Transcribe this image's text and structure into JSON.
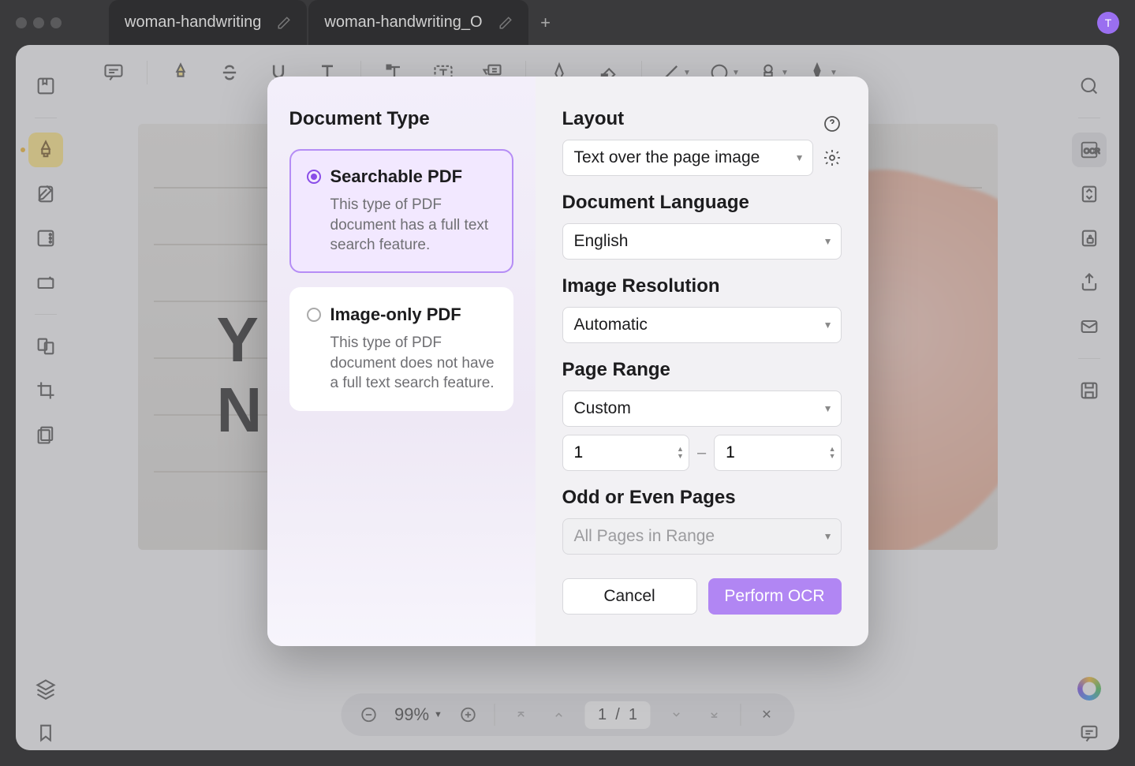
{
  "tabs": {
    "0": "woman-handwriting",
    "1": "woman-handwriting_O"
  },
  "avatar_letter": "T",
  "bottom": {
    "zoom": "99%",
    "page_cur": "1",
    "page_sep": "/",
    "page_total": "1"
  },
  "doc_text_a": "Y",
  "doc_text_b": "N",
  "modal": {
    "doctype_title": "Document Type",
    "opt1_title": "Searchable PDF",
    "opt1_desc": "This type of PDF document has a full text search feature.",
    "opt2_title": "Image-only PDF",
    "opt2_desc": "This type of PDF document does not have a full text search feature.",
    "layout_label": "Layout",
    "layout_value": "Text over the page image",
    "lang_label": "Document Language",
    "lang_value": "English",
    "res_label": "Image Resolution",
    "res_value": "Automatic",
    "range_label": "Page Range",
    "range_value": "Custom",
    "range_from": "1",
    "range_to": "1",
    "oddeven_label": "Odd or Even Pages",
    "oddeven_value": "All Pages in Range",
    "cancel": "Cancel",
    "perform": "Perform OCR"
  }
}
